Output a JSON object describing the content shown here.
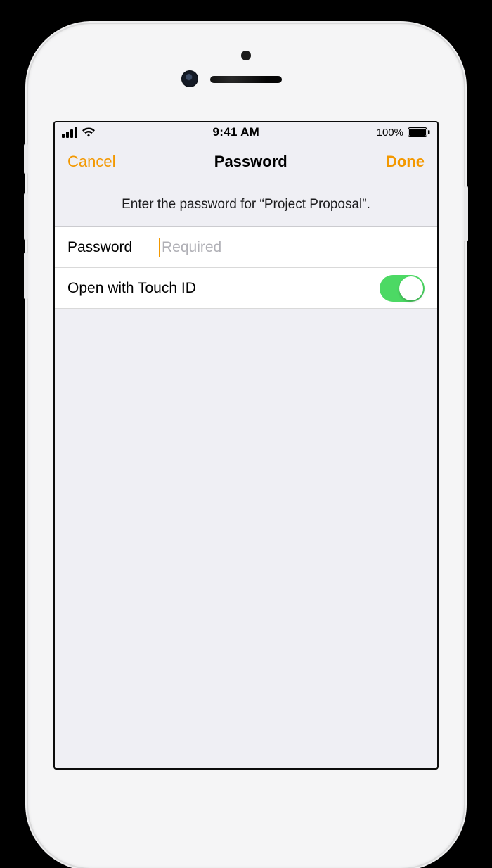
{
  "status_bar": {
    "time": "9:41 AM",
    "battery_pct": "100%"
  },
  "navbar": {
    "cancel_label": "Cancel",
    "title": "Password",
    "done_label": "Done"
  },
  "prompt_text": "Enter the password for “Project Proposal”.",
  "password_row": {
    "label": "Password",
    "placeholder": "Required",
    "value": ""
  },
  "touch_id_row": {
    "label": "Open with Touch ID",
    "enabled": true
  },
  "colors": {
    "accent": "#f39800",
    "toggle_on": "#4cd964"
  }
}
